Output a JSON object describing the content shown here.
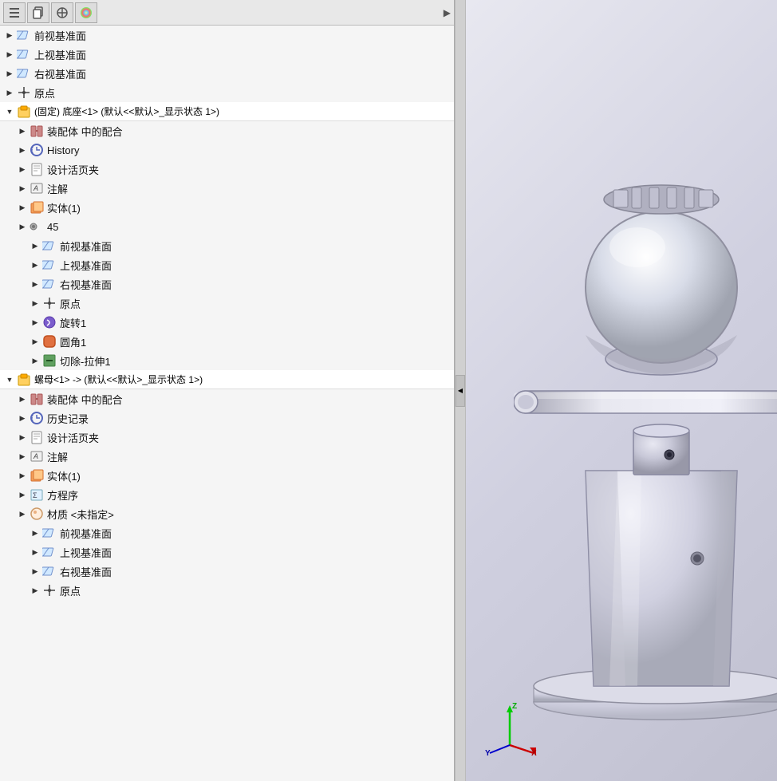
{
  "toolbar": {
    "buttons": [
      "≡",
      "📋",
      "⊕",
      "🎨"
    ],
    "arrow_label": "▶"
  },
  "tree": {
    "items": [
      {
        "id": "front-plane-1",
        "indent": 0,
        "expand": false,
        "icon": "plane",
        "label": "前视基准面",
        "type": "plane"
      },
      {
        "id": "top-plane-1",
        "indent": 0,
        "expand": false,
        "icon": "plane",
        "label": "上视基准面",
        "type": "plane"
      },
      {
        "id": "right-plane-1",
        "indent": 0,
        "expand": false,
        "icon": "plane",
        "label": "右视基准面",
        "type": "plane"
      },
      {
        "id": "origin-1",
        "indent": 0,
        "expand": false,
        "icon": "origin",
        "label": "原点",
        "type": "origin"
      },
      {
        "id": "base-component",
        "indent": 0,
        "expand": true,
        "icon": "component",
        "label": "(固定) 底座<1> (默认<<默认>_显示状态 1>)",
        "type": "component",
        "group": true
      },
      {
        "id": "mates-1",
        "indent": 1,
        "expand": false,
        "icon": "mates",
        "label": "装配体 中的配合",
        "type": "mates"
      },
      {
        "id": "history-1",
        "indent": 1,
        "expand": false,
        "icon": "history",
        "label": "History",
        "type": "history"
      },
      {
        "id": "design-binder-1",
        "indent": 1,
        "expand": false,
        "icon": "design-binder",
        "label": "设计活页夹",
        "type": "design-binder"
      },
      {
        "id": "annotation-1",
        "indent": 1,
        "expand": false,
        "icon": "annotation",
        "label": "注解",
        "type": "annotation"
      },
      {
        "id": "solid-1",
        "indent": 1,
        "expand": false,
        "icon": "solid",
        "label": "实体(1)",
        "type": "solid"
      },
      {
        "id": "num-45",
        "indent": 1,
        "expand": false,
        "icon": "gear-num",
        "label": "45",
        "type": "num-badge"
      },
      {
        "id": "front-plane-2",
        "indent": 2,
        "expand": false,
        "icon": "plane",
        "label": "前视基准面",
        "type": "plane"
      },
      {
        "id": "top-plane-2",
        "indent": 2,
        "expand": false,
        "icon": "plane",
        "label": "上视基准面",
        "type": "plane"
      },
      {
        "id": "right-plane-2",
        "indent": 2,
        "expand": false,
        "icon": "plane",
        "label": "右视基准面",
        "type": "plane"
      },
      {
        "id": "origin-2",
        "indent": 2,
        "expand": false,
        "icon": "origin",
        "label": "原点",
        "type": "origin"
      },
      {
        "id": "revolve-1",
        "indent": 2,
        "expand": false,
        "icon": "revolve",
        "label": "旋转1",
        "type": "feature"
      },
      {
        "id": "fillet-1",
        "indent": 2,
        "expand": false,
        "icon": "fillet",
        "label": "圆角1",
        "type": "feature"
      },
      {
        "id": "cut-1",
        "indent": 2,
        "expand": false,
        "icon": "cut",
        "label": "切除-拉伸1",
        "type": "feature"
      },
      {
        "id": "nut-component",
        "indent": 0,
        "expand": true,
        "icon": "component",
        "label": "螺母<1> -> (默认<<默认>_显示状态 1>)",
        "type": "component",
        "group": true
      },
      {
        "id": "mates-2",
        "indent": 1,
        "expand": false,
        "icon": "mates",
        "label": "装配体 中的配合",
        "type": "mates"
      },
      {
        "id": "history-2",
        "indent": 1,
        "expand": false,
        "icon": "history",
        "label": "历史记录",
        "type": "history"
      },
      {
        "id": "design-binder-2",
        "indent": 1,
        "expand": false,
        "icon": "design-binder",
        "label": "设计活页夹",
        "type": "design-binder"
      },
      {
        "id": "annotation-2",
        "indent": 1,
        "expand": false,
        "icon": "annotation",
        "label": "注解",
        "type": "annotation"
      },
      {
        "id": "solid-2",
        "indent": 1,
        "expand": false,
        "icon": "solid",
        "label": "实体(1)",
        "type": "solid"
      },
      {
        "id": "equation-1",
        "indent": 1,
        "expand": false,
        "icon": "equation",
        "label": "方程序",
        "type": "equation"
      },
      {
        "id": "material-1",
        "indent": 1,
        "expand": false,
        "icon": "material",
        "label": "材质 <未指定>",
        "type": "material"
      },
      {
        "id": "front-plane-3",
        "indent": 2,
        "expand": false,
        "icon": "plane",
        "label": "前视基准面",
        "type": "plane"
      },
      {
        "id": "top-plane-3",
        "indent": 2,
        "expand": false,
        "icon": "plane",
        "label": "上视基准面",
        "type": "plane"
      },
      {
        "id": "right-plane-3",
        "indent": 2,
        "expand": false,
        "icon": "plane",
        "label": "右视基准面",
        "type": "plane"
      },
      {
        "id": "origin-3",
        "indent": 2,
        "expand": false,
        "icon": "origin",
        "label": "原点",
        "type": "origin"
      }
    ]
  },
  "axis": {
    "x_label": "X",
    "y_label": "Y",
    "z_label": "Z"
  }
}
